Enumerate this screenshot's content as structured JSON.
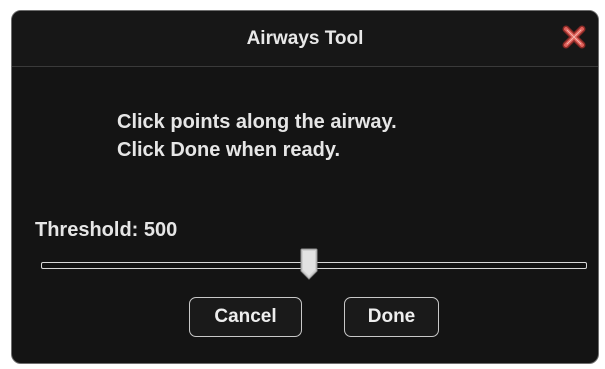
{
  "dialog": {
    "title": "Airways Tool",
    "close_icon": "close-icon",
    "message_line1": "Click points along the airway.",
    "message_line2": "Click Done when ready.",
    "threshold_label": "Threshold:",
    "threshold_value": "500",
    "slider_fraction": 0.49,
    "cancel_label": "Cancel",
    "done_label": "Done"
  },
  "colors": {
    "background": "#141414",
    "text": "#e6e6e6",
    "close_icon": "#d9534f"
  }
}
